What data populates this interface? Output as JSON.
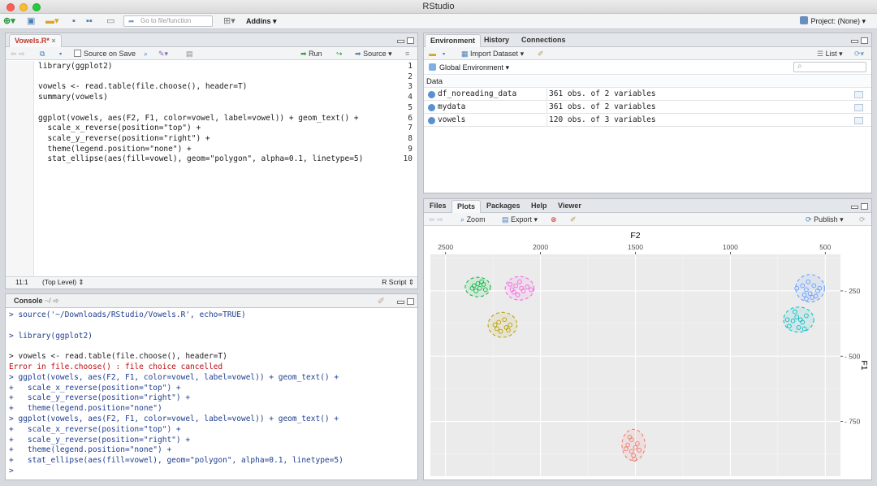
{
  "window": {
    "title": "RStudio"
  },
  "toolbar": {
    "goto_placeholder": "Go to file/function",
    "addins": "Addins",
    "project": "Project: (None)"
  },
  "source": {
    "tab": "Vowels.R*",
    "source_on_save": "Source on Save",
    "run": "Run",
    "source_btn": "Source",
    "lines": [
      {
        "n": "1",
        "text": "library(ggplot2)"
      },
      {
        "n": "2",
        "text": ""
      },
      {
        "n": "3",
        "text": "vowels <- read.table(file.choose(), header=T)"
      },
      {
        "n": "4",
        "text": "summary(vowels)"
      },
      {
        "n": "5",
        "text": ""
      },
      {
        "n": "6",
        "text": "ggplot(vowels, aes(F2, F1, color=vowel, label=vowel)) + geom_text() +"
      },
      {
        "n": "7",
        "text": "  scale_x_reverse(position=\"top\") +"
      },
      {
        "n": "8",
        "text": "  scale_y_reverse(position=\"right\") +"
      },
      {
        "n": "9",
        "text": "  theme(legend.position=\"none\") +"
      },
      {
        "n": "10",
        "text": "  stat_ellipse(aes(fill=vowel), geom=\"polygon\", alpha=0.1, linetype=5)"
      }
    ],
    "cursor_pos": "11:1",
    "scope": "(Top Level)",
    "filetype": "R Script"
  },
  "console": {
    "tab": "Console",
    "path": "~/",
    "lines": [
      {
        "text": "> source('~/Downloads/RStudio/Vowels.R', echo=TRUE)",
        "kind": "cmd"
      },
      {
        "text": "",
        "kind": "cmd"
      },
      {
        "text": "> library(ggplot2)",
        "kind": "cmd"
      },
      {
        "text": "",
        "kind": "cmd"
      },
      {
        "text": "> vowels <- read.table(file.choose(), header=T)",
        "kind": "plain"
      },
      {
        "text": "Error in file.choose() : file choice cancelled",
        "kind": "err"
      },
      {
        "text": "> ggplot(vowels, aes(F2, F1, color=vowel, label=vowel)) + geom_text() +",
        "kind": "cmd"
      },
      {
        "text": "+   scale_x_reverse(position=\"top\") +",
        "kind": "cmd"
      },
      {
        "text": "+   scale_y_reverse(position=\"right\") +",
        "kind": "cmd"
      },
      {
        "text": "+   theme(legend.position=\"none\")",
        "kind": "cmd"
      },
      {
        "text": "> ggplot(vowels, aes(F2, F1, color=vowel, label=vowel)) + geom_text() +",
        "kind": "cmd"
      },
      {
        "text": "+   scale_x_reverse(position=\"top\") +",
        "kind": "cmd"
      },
      {
        "text": "+   scale_y_reverse(position=\"right\") +",
        "kind": "cmd"
      },
      {
        "text": "+   theme(legend.position=\"none\") +",
        "kind": "cmd"
      },
      {
        "text": "+   stat_ellipse(aes(fill=vowel), geom=\"polygon\", alpha=0.1, linetype=5)",
        "kind": "cmd"
      },
      {
        "text": ">",
        "kind": "cmd"
      }
    ]
  },
  "environment": {
    "tabs": [
      "Environment",
      "History",
      "Connections"
    ],
    "import": "Import Dataset",
    "list": "List",
    "global": "Global Environment",
    "section": "Data",
    "rows": [
      {
        "name": "df_noreading_data",
        "value": "361 obs. of 2 variables"
      },
      {
        "name": "mydata",
        "value": "361 obs. of 2 variables"
      },
      {
        "name": "vowels",
        "value": "120 obs. of 3 variables"
      }
    ]
  },
  "files": {
    "tabs": [
      "Files",
      "Plots",
      "Packages",
      "Help",
      "Viewer"
    ],
    "zoom": "Zoom",
    "export": "Export",
    "publish": "Publish"
  },
  "chart_data": {
    "type": "scatter",
    "xlabel": "F2",
    "ylabel": "F1",
    "x_reversed": true,
    "y_reversed": true,
    "x_axis_position": "top",
    "y_axis_position": "right",
    "xlim": [
      2580,
      420
    ],
    "ylim": [
      110,
      960
    ],
    "x_ticks": [
      2500,
      2000,
      1500,
      1000,
      500
    ],
    "y_ticks": [
      250,
      500,
      750
    ],
    "legend": "none",
    "grid": true,
    "series": [
      {
        "color": "#00ba38",
        "cx": 2330,
        "cy": 235,
        "sx": 35,
        "sy": 25,
        "points": [
          [
            2350,
            230
          ],
          [
            2320,
            240
          ],
          [
            2300,
            225
          ],
          [
            2340,
            250
          ],
          [
            2310,
            215
          ],
          [
            2360,
            240
          ],
          [
            2290,
            245
          ],
          [
            2330,
            222
          ]
        ]
      },
      {
        "color": "#f564e3",
        "cx": 2110,
        "cy": 240,
        "sx": 40,
        "sy": 30,
        "points": [
          [
            2130,
            230
          ],
          [
            2090,
            250
          ],
          [
            2150,
            245
          ],
          [
            2110,
            215
          ],
          [
            2070,
            235
          ],
          [
            2120,
            265
          ],
          [
            2100,
            240
          ],
          [
            2160,
            225
          ],
          [
            2050,
            245
          ],
          [
            2140,
            255
          ]
        ]
      },
      {
        "color": "#b79f00",
        "cx": 2200,
        "cy": 380,
        "sx": 40,
        "sy": 32,
        "points": [
          [
            2220,
            370
          ],
          [
            2180,
            390
          ],
          [
            2230,
            395
          ],
          [
            2190,
            360
          ],
          [
            2160,
            380
          ],
          [
            2210,
            405
          ],
          [
            2240,
            380
          ],
          [
            2170,
            400
          ]
        ]
      },
      {
        "color": "#619cff",
        "cx": 580,
        "cy": 240,
        "sx": 40,
        "sy": 35,
        "points": [
          [
            560,
            230
          ],
          [
            600,
            245
          ],
          [
            580,
            260
          ],
          [
            620,
            230
          ],
          [
            540,
            250
          ],
          [
            590,
            215
          ],
          [
            570,
            275
          ],
          [
            610,
            265
          ],
          [
            530,
            240
          ],
          [
            650,
            240
          ],
          [
            550,
            270
          ],
          [
            600,
            280
          ]
        ]
      },
      {
        "color": "#00bfc4",
        "cx": 640,
        "cy": 360,
        "sx": 42,
        "sy": 32,
        "points": [
          [
            650,
            350
          ],
          [
            620,
            370
          ],
          [
            670,
            365
          ],
          [
            600,
            345
          ],
          [
            640,
            390
          ],
          [
            690,
            385
          ],
          [
            610,
            395
          ],
          [
            660,
            330
          ],
          [
            630,
            360
          ],
          [
            700,
            360
          ]
        ]
      },
      {
        "color": "#f8766d",
        "cx": 1510,
        "cy": 840,
        "sx": 32,
        "sy": 40,
        "points": [
          [
            1520,
            820
          ],
          [
            1500,
            850
          ],
          [
            1540,
            840
          ],
          [
            1480,
            860
          ],
          [
            1510,
            880
          ],
          [
            1530,
            810
          ],
          [
            1490,
            835
          ],
          [
            1520,
            865
          ],
          [
            1550,
            855
          ],
          [
            1505,
            895
          ]
        ]
      }
    ]
  }
}
